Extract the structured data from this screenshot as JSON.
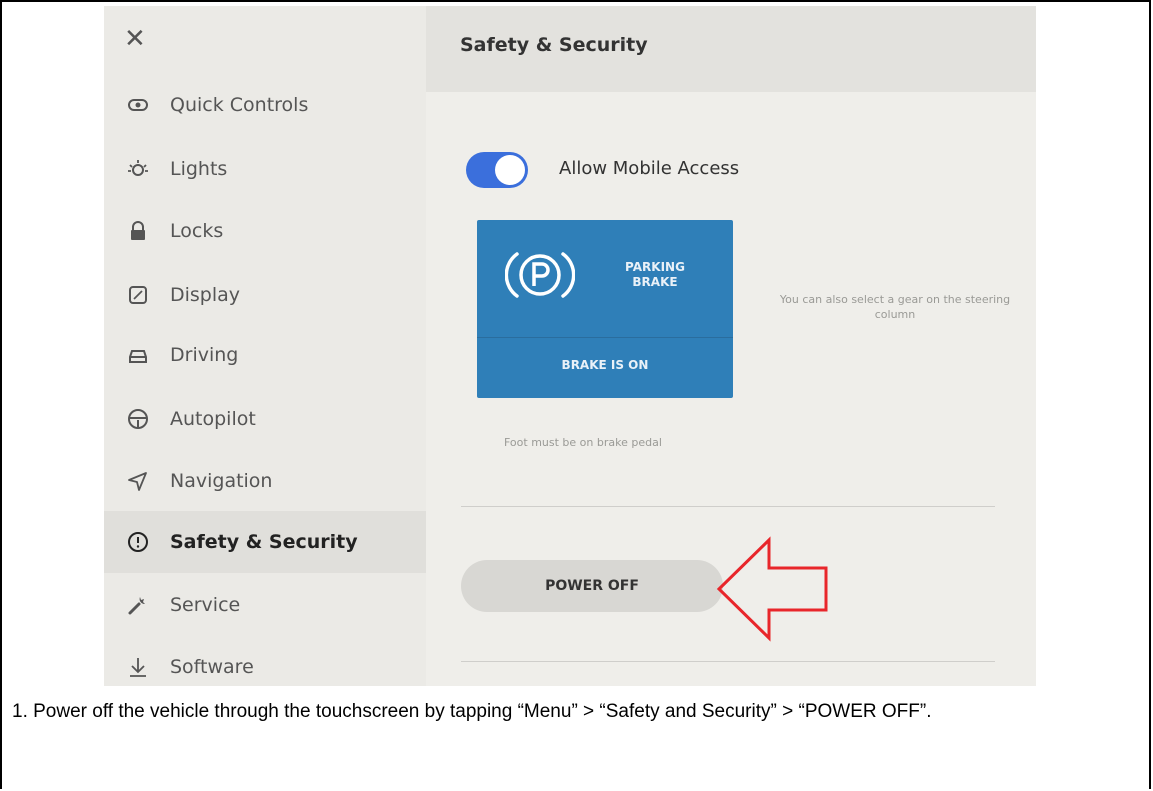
{
  "sidebar": {
    "items": [
      {
        "label": "Quick Controls",
        "icon": "quick-controls-icon"
      },
      {
        "label": "Lights",
        "icon": "lights-icon"
      },
      {
        "label": "Locks",
        "icon": "lock-icon"
      },
      {
        "label": "Display",
        "icon": "display-icon"
      },
      {
        "label": "Driving",
        "icon": "car-icon"
      },
      {
        "label": "Autopilot",
        "icon": "steering-wheel-icon"
      },
      {
        "label": "Navigation",
        "icon": "navigation-arrow-icon"
      },
      {
        "label": "Safety & Security",
        "icon": "alert-circle-icon",
        "active": true
      },
      {
        "label": "Service",
        "icon": "wrench-icon"
      },
      {
        "label": "Software",
        "icon": "download-icon"
      }
    ]
  },
  "main": {
    "title": "Safety & Security",
    "mobile_access": {
      "label": "Allow Mobile Access",
      "enabled": true
    },
    "parking_brake": {
      "line1": "PARKING",
      "line2": "BRAKE",
      "status": "BRAKE IS ON",
      "icon": "parking-brake-icon"
    },
    "gear_hint": "You can also select a gear on the steering column",
    "foot_hint": "Foot must be on brake pedal",
    "power_off_label": "POWER OFF"
  },
  "caption": "1. Power off the vehicle through the touchscreen by tapping “Menu” > “Safety and Security” > “POWER OFF”.",
  "colors": {
    "toggle": "#3b6fdc",
    "brake_card": "#2f7fb8",
    "arrow": "#e8262b"
  }
}
